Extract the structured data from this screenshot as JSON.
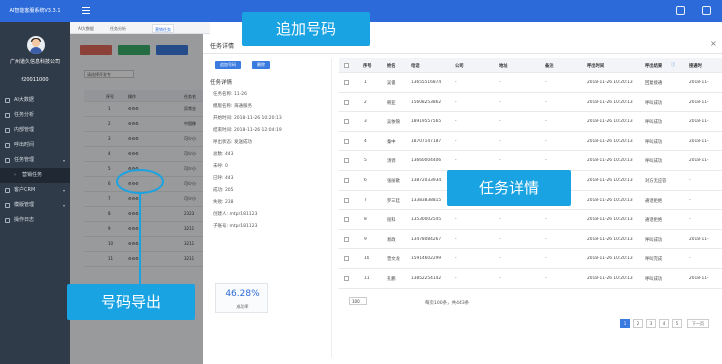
{
  "app": {
    "title": "AI智能客服系统V3.3.1"
  },
  "sidebar": {
    "company": "广州道久信息科技公司",
    "user_id": "f20011000",
    "items": [
      {
        "label": "AI大数据",
        "arrow": ""
      },
      {
        "label": "任务分析",
        "arrow": ""
      },
      {
        "label": "内部管理",
        "arrow": ""
      },
      {
        "label": "呼出时间",
        "arrow": ""
      },
      {
        "label": "任务管理",
        "arrow": "▾"
      },
      {
        "label": "营销任务",
        "arrow": ""
      },
      {
        "label": "客户CRM",
        "arrow": "▾"
      },
      {
        "label": "模版管理",
        "arrow": "▾"
      },
      {
        "label": "操作日志",
        "arrow": ""
      }
    ]
  },
  "tabs": [
    {
      "label": "AI大数据"
    },
    {
      "label": "任务分析"
    },
    {
      "label": "营销任务"
    }
  ],
  "background": {
    "select_placeholder": "请选择开发专",
    "headers": [
      "序号",
      "操作",
      "任务名"
    ],
    "rows": [
      {
        "no": "1",
        "name": "异常业"
      },
      {
        "no": "2",
        "name": "中国移"
      },
      {
        "no": "3",
        "name": "可少小"
      },
      {
        "no": "4",
        "name": "可少小"
      },
      {
        "no": "5",
        "name": "可少小"
      },
      {
        "no": "6",
        "name": "可少小"
      },
      {
        "no": "7",
        "name": "可少小"
      },
      {
        "no": "8",
        "name": "2323"
      },
      {
        "no": "9",
        "name": "3211"
      },
      {
        "no": "10",
        "name": "3211"
      },
      {
        "no": "11",
        "name": "3211"
      }
    ]
  },
  "modal": {
    "title": "任务详情",
    "close": "×",
    "buttons": {
      "export": "追加号码",
      "delete": "删除"
    },
    "detail_title": "任务详情",
    "details": [
      "任务名称: 11-26",
      "模版名称: 海通服务",
      "开始时间: 2018-11-26 10:20:13",
      "结束时间: 2018-11-26 12:04:19",
      "呼出状态: 发送成功",
      "总数: 443",
      "未呼: 0",
      "已呼: 443",
      "成功: 205",
      "失败: 238",
      "创建人: mtpr181123",
      "子账号: mtpr181123"
    ],
    "rate": {
      "value": "46.28%",
      "label": "成功率"
    }
  },
  "table": {
    "headers": [
      "序号",
      "姓名",
      "电话",
      "公司",
      "地址",
      "备注",
      "呼出时间",
      "呼出结果",
      "接通时"
    ],
    "rows": [
      {
        "no": "1",
        "name": "吴俊",
        "phone": "13655516874",
        "company": "-",
        "address": "-",
        "note": "-",
        "time": "2018-11-26 10:20:13",
        "result": "回复接通",
        "connect": "2018-11-"
      },
      {
        "no": "2",
        "name": "韩亚",
        "phone": "15608253862",
        "company": "-",
        "address": "-",
        "note": "-",
        "time": "2018-11-26 10:20:13",
        "result": "呼叫成功",
        "connect": "2018-11-"
      },
      {
        "no": "3",
        "name": "吴依锦",
        "phone": "18919557565",
        "company": "-",
        "address": "-",
        "note": "-",
        "time": "2018-11-26 10:20:13",
        "result": "呼叫成功",
        "connect": "2018-11-"
      },
      {
        "no": "4",
        "name": "秦中",
        "phone": "18707147187",
        "company": "-",
        "address": "-",
        "note": "-",
        "time": "2018-11-26 10:20:13",
        "result": "呼叫成功",
        "connect": "2018-11-"
      },
      {
        "no": "5",
        "name": "汤铧",
        "phone": "13660004406",
        "company": "-",
        "address": "-",
        "note": "-",
        "time": "2018-11-26 10:20:13",
        "result": "呼叫成功",
        "connect": "2018-11-"
      },
      {
        "no": "6",
        "name": "张丽歌",
        "phone": "13872033934",
        "company": "-",
        "address": "-",
        "note": "-",
        "time": "2018-11-26 10:20:13",
        "result": "对方无应答",
        "connect": "-"
      },
      {
        "no": "7",
        "name": "罗三廷",
        "phone": "13383838815",
        "company": "-",
        "address": "-",
        "note": "-",
        "time": "2018-11-26 10:20:13",
        "result": "通话拒绝",
        "connect": "-"
      },
      {
        "no": "8",
        "name": "屈科",
        "phone": "13530002545",
        "company": "-",
        "address": "-",
        "note": "-",
        "time": "2018-11-26 10:20:13",
        "result": "通话拒绝",
        "connect": "-"
      },
      {
        "no": "9",
        "name": "易政",
        "phone": "13478084267",
        "company": "-",
        "address": "-",
        "note": "-",
        "time": "2018-11-26 10:20:13",
        "result": "呼叫成功",
        "connect": "2018-11-"
      },
      {
        "no": "10",
        "name": "曾文龙",
        "phone": "15914602299",
        "company": "-",
        "address": "-",
        "note": "-",
        "time": "2018-11-26 10:20:13",
        "result": "呼叫完成",
        "connect": "-"
      },
      {
        "no": "11",
        "name": "孔鹏",
        "phone": "13852254142",
        "company": "-",
        "address": "-",
        "note": "-",
        "time": "2018-11-26 10:20:13",
        "result": "呼叫成功",
        "connect": "2018-11-"
      }
    ]
  },
  "pagination": {
    "page_size": "100",
    "info": "每页100条，共443条",
    "pages": [
      "1",
      "2",
      "3",
      "4",
      "5"
    ],
    "next": "下一页"
  },
  "callouts": {
    "add_numbers": "追加号码",
    "task_detail": "任务详情",
    "export_numbers": "号码导出"
  },
  "colors": {
    "primary": "#2b6ad8",
    "sidebar": "#2f3b48",
    "callout": "#1aa3e2"
  }
}
